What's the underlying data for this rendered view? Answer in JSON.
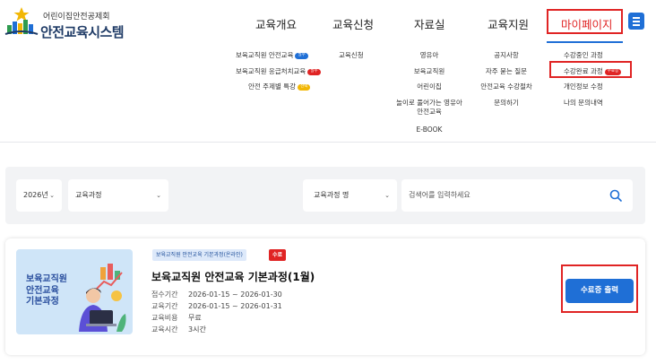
{
  "logo": {
    "subtitle": "어린이집안전공제회",
    "title": "안전교육시스템"
  },
  "gnb": {
    "items": [
      "교육개요",
      "교육신청",
      "자료실",
      "교육지원",
      "마이페이지"
    ],
    "active_index": 4
  },
  "megamenu": {
    "col1": [
      {
        "label": "보육교직원 안전교육",
        "badge": "필수"
      },
      {
        "label": "보육교직원 응급처치교육",
        "badge": "필수"
      },
      {
        "label": "안전 주제별 특강",
        "badge": "선택"
      }
    ],
    "col2": [
      "교육신청"
    ],
    "col3": [
      "영유아",
      "보육교직원",
      "어린이집",
      "놀이로 풀어가는 영유아",
      "안전교육",
      "E-BOOK"
    ],
    "col4": [
      "공지사항",
      "자주 묻는 질문",
      "안전교육 수강절차",
      "문의하기"
    ],
    "col5": [
      {
        "label": "수강중인 과정"
      },
      {
        "label": "수강완료 과정",
        "badge": "수료증"
      },
      {
        "label": "개인정보 수정"
      },
      {
        "label": "나의 문의내역"
      }
    ]
  },
  "search": {
    "year": "2026년",
    "course_select": "교육과정",
    "field_select": "교육과정 명",
    "placeholder": "검색어를 입력하세요"
  },
  "course": {
    "category_tag": "보육교직원 안전교육 기본과정(온라인)",
    "status_tag": "수료",
    "title": "보육교직원 안전교육 기본과정(1월)",
    "thumbnail_text": [
      "보육교직원",
      "안전교육",
      "기본과정"
    ],
    "info": [
      {
        "label": "접수기간",
        "value": "2026-01-15 ~ 2026-01-30"
      },
      {
        "label": "교육기간",
        "value": "2026-01-15 ~ 2026-01-31"
      },
      {
        "label": "교육비용",
        "value": "무료"
      },
      {
        "label": "교육시간",
        "value": "3시간"
      }
    ],
    "print_button": "수료증 출력"
  },
  "colors": {
    "accent": "#1f6fd6",
    "highlight": "#e02424",
    "brand_navy": "#1f3b66"
  }
}
